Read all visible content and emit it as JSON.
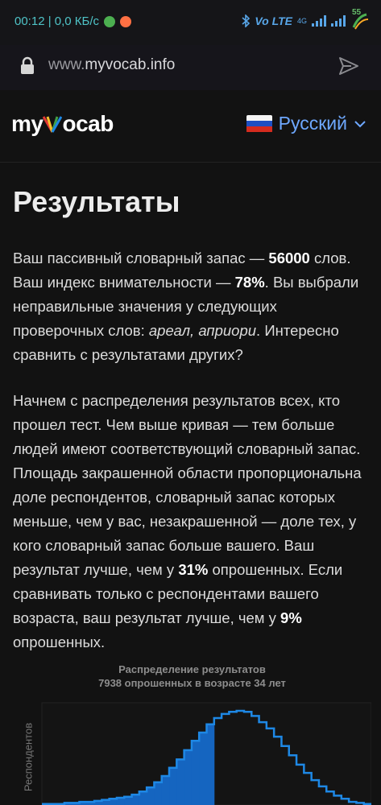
{
  "status_bar": {
    "time_speed": "00:12 | 0,0 КБ/с",
    "network_label": "Vo LTE",
    "net_gen": "4G",
    "battery_level": "55"
  },
  "browser": {
    "url_prefix": "www.",
    "url_domain": "myvocab.info"
  },
  "header": {
    "logo_pre": "my",
    "logo_post": "ocab",
    "language": "Русский"
  },
  "page": {
    "title": "Результаты",
    "para1": {
      "t1": "Ваш пассивный словарный запас — ",
      "vocab": "56000",
      "t2": " слов. Ваш индекс внимательности — ",
      "attention": "78%",
      "t3": ". Вы выбрали неправильные значения у следующих проверочных слов: ",
      "wrong_words": "ареал, априори",
      "t4": ". Интересно сравнить с результатами других?"
    },
    "para2": {
      "t1": "Начнем с распределения результатов всех, кто прошел тест. Чем выше кривая — тем больше людей имеют соответствующий словарный запас. Площадь закрашенной области пропорциональна доле респондентов, словарный запас которых меньше, чем у вас, незакрашенной — доле тех, у кого словарный запас больше вашего. Ваш результат лучше, чем у ",
      "all_pct": "31%",
      "t2": " опрошенных. Если сравнивать только с респондентами вашего возраста, ваш результат лучше, чем у ",
      "age_pct": "9%",
      "t3": " опрошенных."
    }
  },
  "chart_data": {
    "type": "area",
    "title": "Распределение результатов",
    "subtitle": "7938 опрошенных в возрасте 34 лет",
    "ylabel": "Респондентов",
    "xlabel": "",
    "shaded_fraction": 0.31,
    "series": [
      {
        "values": [
          1,
          1,
          1,
          2,
          2,
          3,
          3,
          4,
          5,
          6,
          7,
          8,
          10,
          13,
          17,
          22,
          28,
          36,
          44,
          53,
          62,
          70,
          78,
          84,
          88,
          90,
          91,
          90,
          86,
          80,
          74,
          66,
          57,
          48,
          39,
          31,
          24,
          18,
          13,
          9,
          6,
          3,
          2,
          1
        ]
      }
    ],
    "accent_color": "#1565c0",
    "line_color": "#1e88e5"
  }
}
